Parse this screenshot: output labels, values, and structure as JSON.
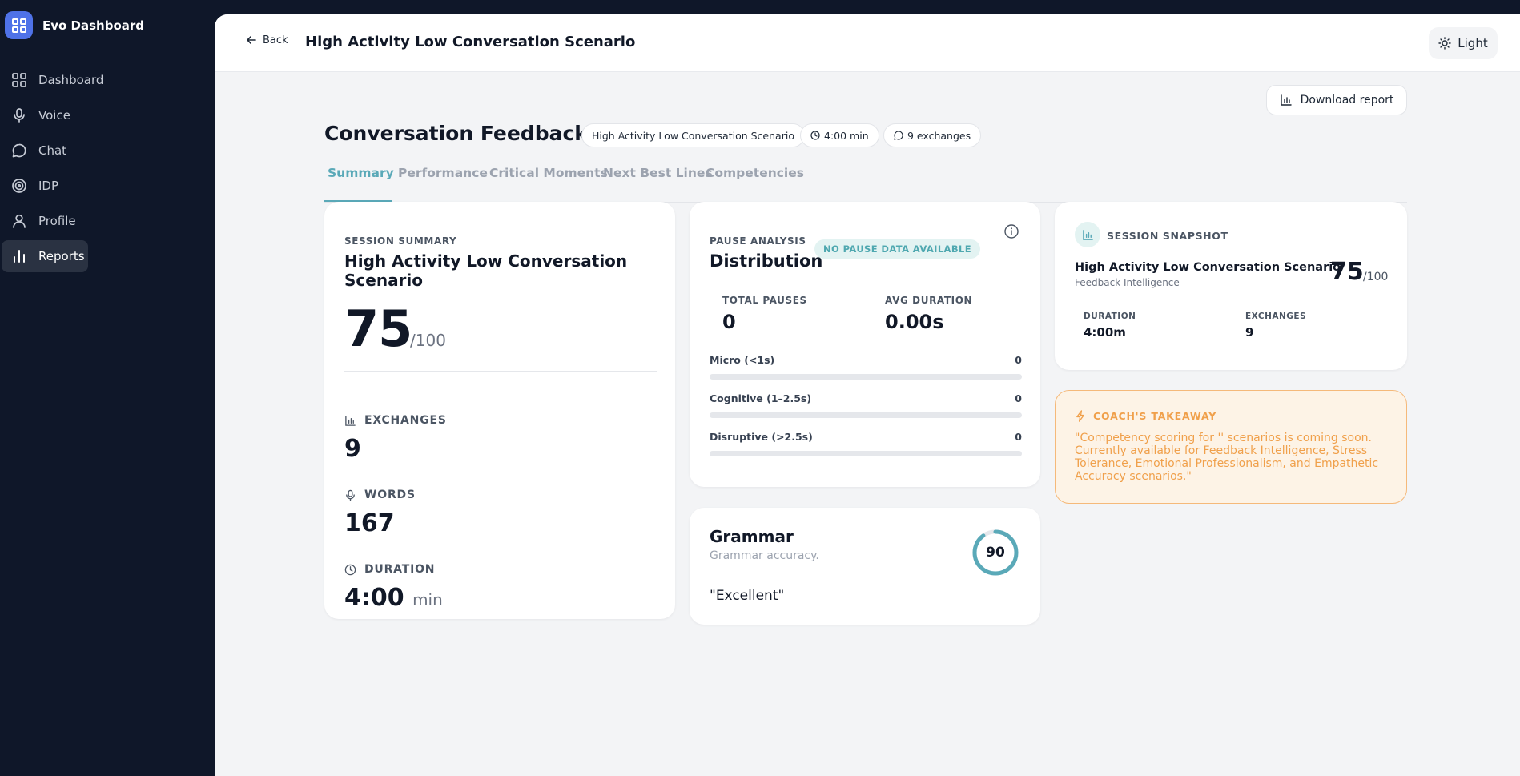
{
  "app": {
    "name": "Evo Dashboard"
  },
  "sidebar": {
    "items": [
      {
        "label": "Dashboard",
        "icon": "grid-icon",
        "active": false
      },
      {
        "label": "Voice",
        "icon": "mic-icon",
        "active": false
      },
      {
        "label": "Chat",
        "icon": "chat-bubble-icon",
        "active": false
      },
      {
        "label": "IDP",
        "icon": "target-icon",
        "active": false
      },
      {
        "label": "Profile",
        "icon": "user-icon",
        "active": false
      },
      {
        "label": "Reports",
        "icon": "bar-chart-icon",
        "active": true
      }
    ]
  },
  "header": {
    "back_label": "Back",
    "title": "High Activity Low Conversation Scenario",
    "theme_label": "Light"
  },
  "toolbar": {
    "download_label": "Download report"
  },
  "page": {
    "title": "Conversation Feedback",
    "separator": "-",
    "chips": {
      "scenario": "High Activity Low Conversation Scenario",
      "duration": "4:00 min",
      "exchanges": "9 exchanges"
    }
  },
  "tabs": [
    {
      "label": "Summary",
      "active": true
    },
    {
      "label": "Performance",
      "active": false
    },
    {
      "label": "Critical Moments",
      "active": false
    },
    {
      "label": "Next Best Lines",
      "active": false
    },
    {
      "label": "Competencies",
      "active": false
    }
  ],
  "session_summary": {
    "label": "SESSION SUMMARY",
    "title": "High Activity Low Conversation Scenario",
    "score": "75",
    "score_max": "/100",
    "exchanges_label": "EXCHANGES",
    "exchanges_value": "9",
    "words_label": "WORDS",
    "words_value": "167",
    "duration_label": "DURATION",
    "duration_value": "4:00",
    "duration_unit": "min"
  },
  "pause_analysis": {
    "label": "PAUSE ANALYSIS",
    "title": "Distribution",
    "badge": "NO PAUSE DATA AVAILABLE",
    "total_label": "TOTAL PAUSES",
    "total_value": "0",
    "avg_label": "AVG DURATION",
    "avg_value": "0.00s",
    "bars": [
      {
        "label": "Micro (<1s)",
        "value": "0",
        "fraction": 0
      },
      {
        "label": "Cognitive (1–2.5s)",
        "value": "0",
        "fraction": 0
      },
      {
        "label": "Disruptive (>2.5s)",
        "value": "0",
        "fraction": 0
      }
    ]
  },
  "grammar": {
    "title": "Grammar",
    "subtitle": "Grammar accuracy.",
    "score": "90",
    "score_fraction": 0.9,
    "quote": "\"Excellent\""
  },
  "snapshot": {
    "label": "SESSION SNAPSHOT",
    "title": "High Activity Low Conversation Scenario",
    "subtitle": "Feedback Intelligence",
    "score": "75",
    "score_max": "/100",
    "duration_label": "DURATION",
    "duration_value": "4:00m",
    "exchanges_label": "EXCHANGES",
    "exchanges_value": "9"
  },
  "coach": {
    "label": "COACH'S TAKEAWAY",
    "text": "\"Competency scoring for '' scenarios is coming soon. Currently available for Feedback Intelligence, Stress Tolerance, Emotional Professionalism, and Empathetic Accuracy scenarios.\""
  },
  "colors": {
    "accent": "#5aa9b8",
    "brand": "#4f72e8",
    "sidebar_bg": "#0f1729",
    "warning_text": "#f0a04b"
  }
}
